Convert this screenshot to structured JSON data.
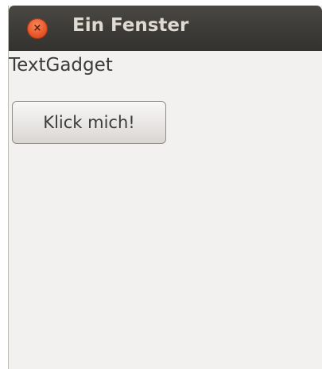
{
  "window": {
    "title": "Ein Fenster",
    "close_icon_glyph": "×"
  },
  "content": {
    "text_gadget": "TextGadget",
    "button_label": "Klick mich!"
  },
  "colors": {
    "titlebar": "#3c3b37",
    "close_button": "#e9572a",
    "window_background": "#f2f1f0"
  }
}
